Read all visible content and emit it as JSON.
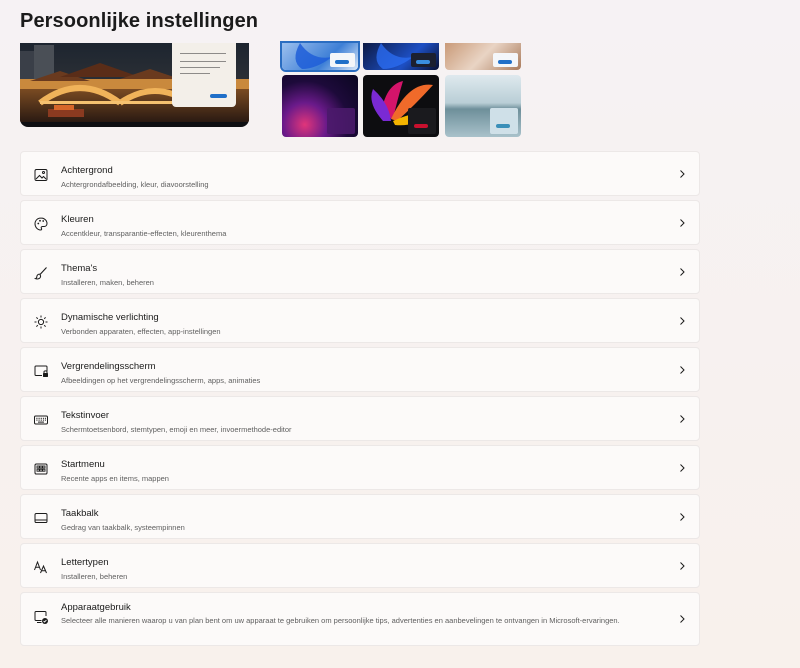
{
  "page": {
    "title": "Persoonlijke instellingen"
  },
  "colors": {
    "accent": "#1f6fc8",
    "selection_border": "#2a6dc1",
    "row_bg": "#fcfaf9",
    "glow_red": "#c8102e"
  },
  "preview": {
    "image": "lit-bridge-over-water-night"
  },
  "themes": [
    {
      "name": "windows-light-bloom",
      "selected": true
    },
    {
      "name": "windows-dark-bloom",
      "selected": false
    },
    {
      "name": "photo-beach",
      "selected": false
    },
    {
      "name": "purple-glow",
      "selected": false
    },
    {
      "name": "captured-motion-flower",
      "selected": false
    },
    {
      "name": "flow-lake",
      "selected": false
    }
  ],
  "settings": [
    {
      "icon": "picture-icon",
      "title": "Achtergrond",
      "subtitle": "Achtergrondafbeelding, kleur, diavoorstelling"
    },
    {
      "icon": "palette-icon",
      "title": "Kleuren",
      "subtitle": "Accentkleur, transparantie-effecten, kleurenthema"
    },
    {
      "icon": "brush-icon",
      "title": "Thema's",
      "subtitle": "Installeren, maken, beheren"
    },
    {
      "icon": "sparkle-icon",
      "title": "Dynamische verlichting",
      "subtitle": "Verbonden apparaten, effecten, app-instellingen"
    },
    {
      "icon": "lock-screen-icon",
      "title": "Vergrendelingsscherm",
      "subtitle": "Afbeeldingen op het vergrendelingsscherm, apps, animaties"
    },
    {
      "icon": "keyboard-icon",
      "title": "Tekstinvoer",
      "subtitle": "Schermtoetsenbord, stemtypen, emoji en meer, invoermethode-editor"
    },
    {
      "icon": "start-menu-icon",
      "title": "Startmenu",
      "subtitle": "Recente apps en items, mappen"
    },
    {
      "icon": "taskbar-icon",
      "title": "Taakbalk",
      "subtitle": "Gedrag van taakbalk, systeempinnen"
    },
    {
      "icon": "fonts-icon",
      "title": "Lettertypen",
      "subtitle": "Installeren, beheren"
    },
    {
      "icon": "device-usage-icon",
      "title": "Apparaatgebruik",
      "subtitle": "Selecteer alle manieren waarop u van plan bent om uw apparaat te gebruiken om persoonlijke tips, advertenties en aanbevelingen te ontvangen in Microsoft-ervaringen."
    }
  ]
}
